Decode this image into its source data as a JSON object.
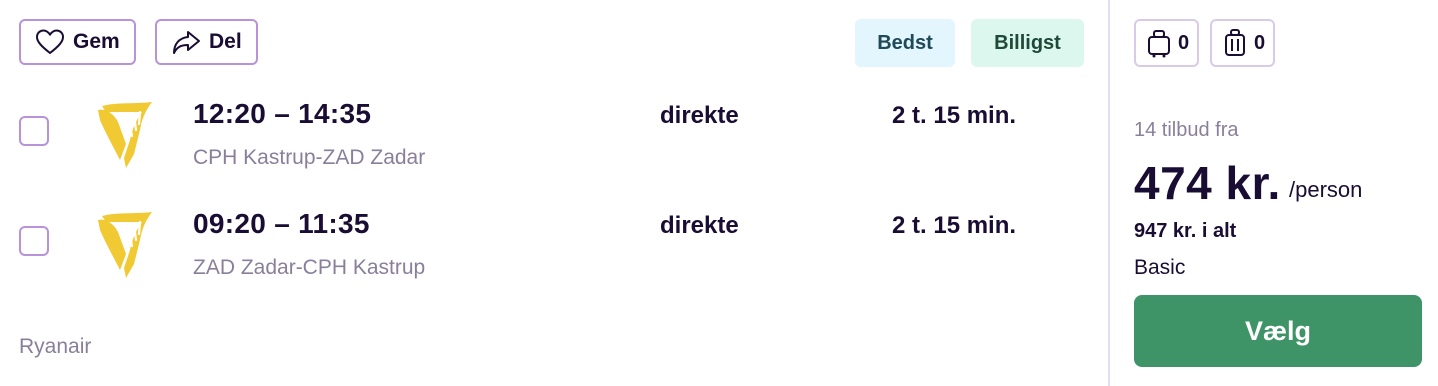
{
  "actions": {
    "save_label": "Gem",
    "share_label": "Del"
  },
  "badges": {
    "best": {
      "label": "Bedst",
      "bg": "#e3f5fd",
      "color": "#1f4a57"
    },
    "cheapest": {
      "label": "Billigst",
      "bg": "#dcf7ee",
      "color": "#1f4a3a"
    }
  },
  "flights": [
    {
      "time": "12:20 – 14:35",
      "route": "CPH Kastrup-ZAD Zadar",
      "stops": "direkte",
      "duration": "2 t. 15 min.",
      "logo_icon": "ryanair-harp-icon"
    },
    {
      "time": "09:20 – 11:35",
      "route": "ZAD Zadar-CPH Kastrup",
      "stops": "direkte",
      "duration": "2 t. 15 min.",
      "logo_icon": "ryanair-harp-icon"
    }
  ],
  "carrier": "Ryanair",
  "baggage": {
    "cabin": {
      "icon": "cabin-bag-icon",
      "count": "0"
    },
    "checked": {
      "icon": "checked-bag-icon",
      "count": "0"
    }
  },
  "pricing": {
    "offers": "14 tilbud fra",
    "price": "474 kr.",
    "per": "/person",
    "total": "947 kr. i alt",
    "fare": "Basic",
    "select_label": "Vælg"
  },
  "colors": {
    "accent": "#b893d9",
    "select_button": "#3f9467",
    "logo": "#f1c933"
  }
}
